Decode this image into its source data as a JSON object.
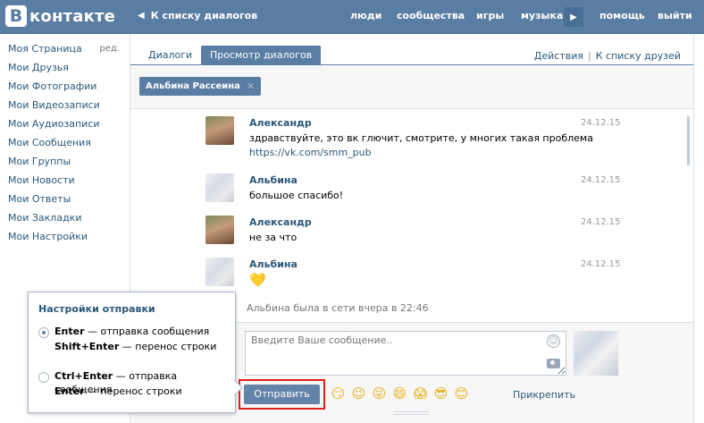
{
  "header": {
    "logo_letter": "В",
    "logo_text": "контакте",
    "back_label": "К списку диалогов",
    "nav": [
      "люди",
      "сообщества",
      "игры",
      "музыка",
      "помощь",
      "выйти"
    ]
  },
  "left_menu": {
    "items": [
      "Моя Страница",
      "Мои Друзья",
      "Мои Фотографии",
      "Мои Видеозаписи",
      "Мои Аудиозаписи",
      "Мои Сообщения",
      "Мои Группы",
      "Мои Новости",
      "Мои Ответы",
      "Мои Закладки",
      "Мои Настройки"
    ],
    "edit_label": "ред."
  },
  "tabs": {
    "items": [
      "Диалоги",
      "Просмотр диалогов"
    ],
    "actions_label": "Действия",
    "friends_label": "К списку друзей",
    "separator": "|"
  },
  "peer": {
    "name": "Альбина Рассеина",
    "close_glyph": "✕"
  },
  "messages": [
    {
      "author": "Александр",
      "text": "здравствуйте, это вк глючит, смотрите, у многих такая проблема",
      "link": "https://vk.com/smm_pub",
      "date": "24.12.15"
    },
    {
      "author": "Альбина",
      "text": "большое спасибо!",
      "date": "24.12.15"
    },
    {
      "author": "Александр",
      "text": "не за что",
      "date": "24.12.15"
    },
    {
      "author": "Альбина",
      "text": "💛",
      "date": "24.12.15"
    }
  ],
  "status_line": "Альбина была в сети вчера в 22:46",
  "composer": {
    "placeholder": "Введите Ваше сообщение..",
    "send_label": "Отправить",
    "attach_label": "Прикрепить",
    "emojis": [
      "😏",
      "😉",
      "😜",
      "😄",
      "😱",
      "😎",
      "😊"
    ]
  },
  "send_settings": {
    "title": "Настройки отправки",
    "option1": {
      "key1": "Enter",
      "desc1": " — отправка сообщения",
      "key2": "Shift+Enter",
      "desc2": " — перенос строки"
    },
    "option2": {
      "key1": "Ctrl+Enter",
      "desc1": " — отправка сообщения",
      "key2": "Enter",
      "desc2": " — перенос строки"
    }
  }
}
